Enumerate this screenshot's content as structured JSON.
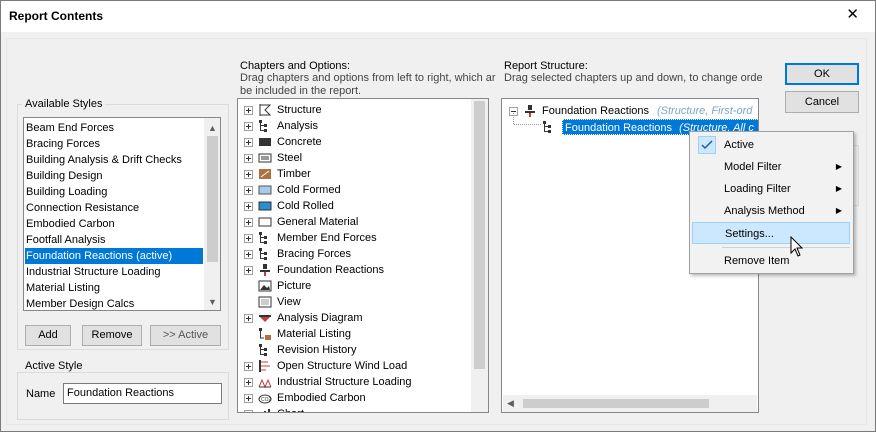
{
  "window": {
    "title": "Report Contents",
    "close": "✕"
  },
  "available_styles": {
    "label": "Available Styles",
    "items": [
      "Beam End Forces",
      "Bracing Forces",
      "Building Analysis & Drift Checks",
      "Building Design",
      "Building Loading",
      "Connection Resistance",
      "Embodied Carbon",
      "Footfall Analysis",
      "Foundation Reactions (active)",
      "Industrial Structure Loading",
      "Material Listing",
      "Member Design Calcs"
    ],
    "selected_index": 8,
    "buttons": {
      "add": "Add",
      "remove": "Remove",
      "active": ">> Active"
    }
  },
  "active_style": {
    "label": "Active Style",
    "name_label": "Name",
    "name_value": "Foundation Reactions"
  },
  "chapters": {
    "header_line1": "Chapters and Options:",
    "header_line2": "Drag chapters and options from left to right, which ar",
    "header_line3": "be included in the report.",
    "items": [
      {
        "label": "Structure",
        "icon": "structure-icon",
        "expand": true
      },
      {
        "label": "Analysis",
        "icon": "tree-icon",
        "expand": true
      },
      {
        "label": "Concrete",
        "icon": "concrete-icon",
        "expand": true
      },
      {
        "label": "Steel",
        "icon": "steel-icon",
        "expand": true
      },
      {
        "label": "Timber",
        "icon": "timber-icon",
        "expand": true
      },
      {
        "label": "Cold Formed",
        "icon": "cold-formed-icon",
        "expand": true
      },
      {
        "label": "Cold Rolled",
        "icon": "cold-rolled-icon",
        "expand": true
      },
      {
        "label": "General Material",
        "icon": "general-material-icon",
        "expand": true
      },
      {
        "label": "Member End Forces",
        "icon": "tree-icon",
        "expand": true
      },
      {
        "label": "Bracing Forces",
        "icon": "tree-icon",
        "expand": true
      },
      {
        "label": "Foundation Reactions",
        "icon": "foundation-icon",
        "expand": true
      },
      {
        "label": "Picture",
        "icon": "picture-icon",
        "expand": false
      },
      {
        "label": "View",
        "icon": "view-icon",
        "expand": false
      },
      {
        "label": "Analysis Diagram",
        "icon": "diagram-icon",
        "expand": true
      },
      {
        "label": "Material Listing",
        "icon": "material-listing-icon",
        "expand": false
      },
      {
        "label": "Revision History",
        "icon": "tree-icon",
        "expand": false
      },
      {
        "label": "Open Structure Wind Load",
        "icon": "wind-icon",
        "expand": true
      },
      {
        "label": "Industrial Structure Loading",
        "icon": "industrial-icon",
        "expand": true
      },
      {
        "label": "Embodied Carbon",
        "icon": "carbon-icon",
        "expand": true
      },
      {
        "label": "Chart",
        "icon": "chart-icon",
        "expand": true
      }
    ]
  },
  "structure": {
    "header_line1": "Report Structure:",
    "header_line2": "Drag selected chapters up and down, to change orde",
    "root_label": "Foundation Reactions",
    "root_note": "(Structure, First-ord",
    "child_label": "Foundation Reactions",
    "child_note": "(Structure, All c"
  },
  "buttons": {
    "ok": "OK",
    "cancel": "Cancel"
  },
  "context_menu": {
    "items": [
      {
        "label": "Active",
        "checked": true,
        "submenu": false
      },
      {
        "label": "Model Filter",
        "checked": false,
        "submenu": true
      },
      {
        "label": "Loading Filter",
        "checked": false,
        "submenu": true
      },
      {
        "label": "Analysis Method",
        "checked": false,
        "submenu": true
      },
      {
        "label": "Settings...",
        "checked": false,
        "submenu": false,
        "highlighted": true
      },
      {
        "label": "Remove Item",
        "checked": false,
        "submenu": false
      }
    ]
  },
  "colors": {
    "selection": "#0078d7",
    "highlight": "#cce8ff",
    "dialog_bg": "#f0f0f0",
    "note_text": "#7aa6c8"
  }
}
